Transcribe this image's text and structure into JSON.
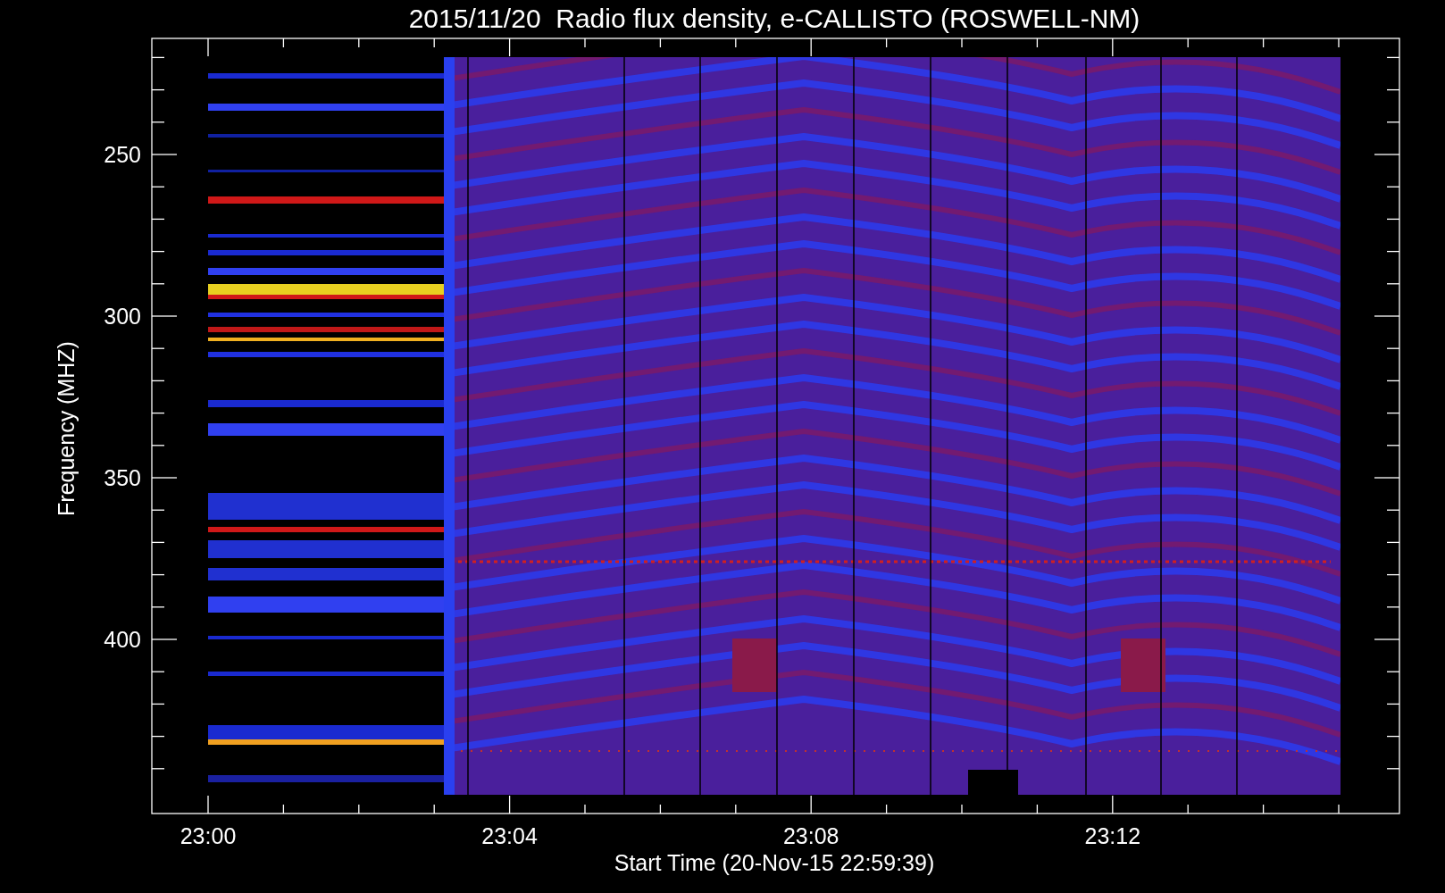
{
  "title": "2015/11/20  Radio flux density, e-CALLISTO (ROSWELL-NM)",
  "y_axis": {
    "label": "Frequency (MHZ)",
    "ticks": [
      "250",
      "300",
      "350",
      "400"
    ]
  },
  "x_axis": {
    "label": "Start Time (20-Nov-15 22:59:39)",
    "ticks": [
      "23:00",
      "23:04",
      "23:08",
      "23:12"
    ]
  }
}
